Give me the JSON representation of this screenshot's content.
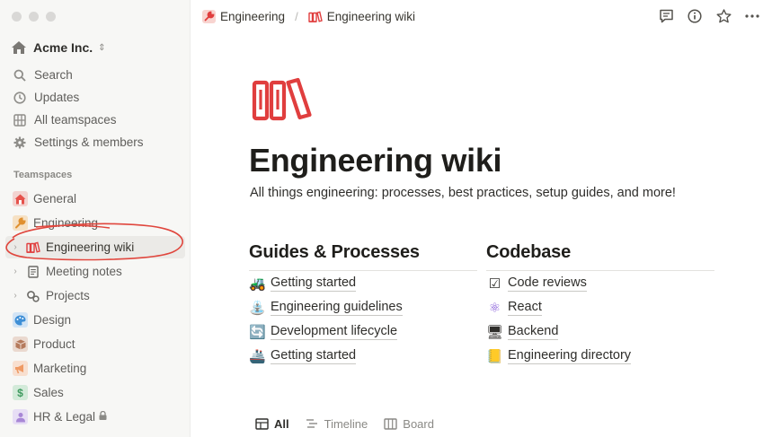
{
  "workspace": {
    "name": "Acme Inc."
  },
  "nav": [
    {
      "key": "search",
      "label": "Search",
      "icon": "search-icon"
    },
    {
      "key": "updates",
      "label": "Updates",
      "icon": "clock-icon"
    },
    {
      "key": "teamspaces",
      "label": "All teamspaces",
      "icon": "grid-icon"
    },
    {
      "key": "settings",
      "label": "Settings & members",
      "icon": "gear-icon"
    }
  ],
  "teamspaces_label": "Teamspaces",
  "teamspaces": [
    {
      "label": "General",
      "icon": "house-icon",
      "color": "#f0645a"
    },
    {
      "label": "Engineering",
      "icon": "wrench-icon",
      "color": "#f0a24a"
    },
    {
      "label": "Engineering wiki",
      "icon": "books-icon",
      "color": "#e03e3e"
    },
    {
      "label": "Meeting notes",
      "icon": "document-icon",
      "color": "#6b6a66"
    },
    {
      "label": "Projects",
      "icon": "gears-icon",
      "color": "#6b6a66"
    },
    {
      "label": "Design",
      "icon": "palette-icon",
      "color": "#3e8fd6"
    },
    {
      "label": "Product",
      "icon": "box-icon",
      "color": "#b57a5c"
    },
    {
      "label": "Marketing",
      "icon": "megaphone-icon",
      "color": "#f0a070"
    },
    {
      "label": "Sales",
      "icon": "dollar-icon",
      "color": "#4aa36a"
    },
    {
      "label": "HR & Legal",
      "icon": "person-icon",
      "color": "#a887d6"
    }
  ],
  "breadcrumb": [
    {
      "label": "Engineering",
      "icon": "wrench-icon"
    },
    {
      "label": "Engineering wiki",
      "icon": "books-icon"
    }
  ],
  "page": {
    "title": "Engineering wiki",
    "description": "All things engineering: processes, best practices, setup guides, and more!",
    "accent": "#e03e3e"
  },
  "columns": [
    {
      "heading": "Guides & Processes",
      "links": [
        {
          "label": "Getting started",
          "icon": "tractor-icon",
          "glyph": "🚜"
        },
        {
          "label": "Engineering guidelines",
          "icon": "fountain-icon",
          "glyph": "⛲"
        },
        {
          "label": "Development lifecycle",
          "icon": "cycle-icon",
          "glyph": "🔄"
        },
        {
          "label": "Getting started",
          "icon": "ship-icon",
          "glyph": "🚢"
        }
      ]
    },
    {
      "heading": "Codebase",
      "links": [
        {
          "label": "Code reviews",
          "icon": "checkbox-icon",
          "glyph": "☑"
        },
        {
          "label": "React",
          "icon": "atom-icon",
          "glyph": "⚛"
        },
        {
          "label": "Backend",
          "icon": "monitor-icon",
          "glyph": "🖥"
        },
        {
          "label": "Engineering directory",
          "icon": "folder-icon",
          "glyph": "📒"
        }
      ]
    }
  ],
  "view_tabs": [
    {
      "label": "All",
      "icon": "table-icon",
      "selected": true
    },
    {
      "label": "Timeline",
      "icon": "timeline-icon",
      "selected": false
    },
    {
      "label": "Board",
      "icon": "board-icon",
      "selected": false
    }
  ]
}
